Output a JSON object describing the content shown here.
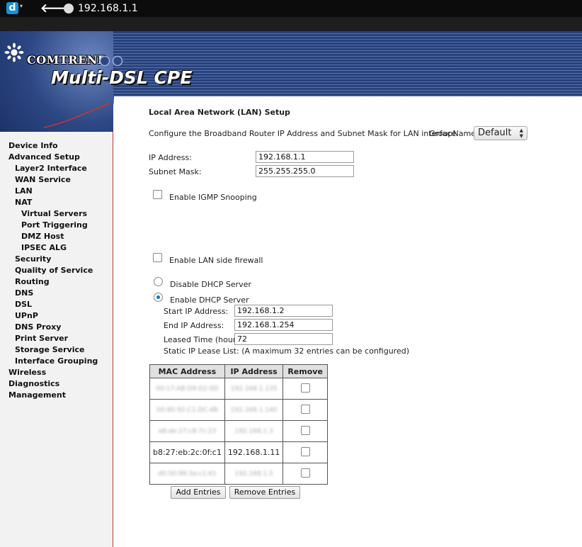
{
  "browser": {
    "address": "192.168.1.1",
    "app_icon_letter": "d",
    "icons": {
      "app": "d-browser-icon",
      "back": "back-arrow-icon",
      "site": "globe-icon"
    }
  },
  "banner": {
    "brand": "COMTREND",
    "product": "Multi-DSL CPE",
    "colors": {
      "banner_dark": "#243a6e",
      "banner_light": "#8fa3cc",
      "divider_red": "#cc3333"
    }
  },
  "sidebar": {
    "items": [
      {
        "label": "Device Info"
      },
      {
        "label": "Advanced Setup"
      },
      {
        "label": "Layer2 Interface"
      },
      {
        "label": "WAN Service"
      },
      {
        "label": "LAN"
      },
      {
        "label": "NAT"
      },
      {
        "label": "Virtual Servers"
      },
      {
        "label": "Port Triggering"
      },
      {
        "label": "DMZ Host"
      },
      {
        "label": "IPSEC ALG"
      },
      {
        "label": "Security"
      },
      {
        "label": "Quality of Service"
      },
      {
        "label": "Routing"
      },
      {
        "label": "DNS"
      },
      {
        "label": "DSL"
      },
      {
        "label": "UPnP"
      },
      {
        "label": "DNS Proxy"
      },
      {
        "label": "Print Server"
      },
      {
        "label": "Storage Service"
      },
      {
        "label": "Interface Grouping"
      },
      {
        "label": "Wireless"
      },
      {
        "label": "Diagnostics"
      },
      {
        "label": "Management"
      }
    ]
  },
  "main": {
    "title": "Local Area Network (LAN) Setup",
    "description": "Configure the Broadband Router IP Address and Subnet Mask for LAN interface.",
    "group_name_label": "GroupName",
    "group_name_value": "Default",
    "ip_address_label": "IP Address:",
    "ip_address_value": "192.168.1.1",
    "subnet_mask_label": "Subnet Mask:",
    "subnet_mask_value": "255.255.255.0",
    "igmp_label": "Enable IGMP Snooping",
    "igmp_checked": false,
    "firewall_label": "Enable LAN side firewall",
    "firewall_checked": false,
    "dhcp_disable_label": "Disable DHCP Server",
    "dhcp_enable_label": "Enable DHCP Server",
    "dhcp_selected": "enable",
    "start_ip_label": "Start IP Address:",
    "start_ip_value": "192.168.1.2",
    "end_ip_label": "End IP Address:",
    "end_ip_value": "192.168.1.254",
    "lease_time_label": "Leased Time (hour):",
    "lease_time_value": "72",
    "static_lease_note": "Static IP Lease List: (A maximum 32 entries can be configured)",
    "table": {
      "headers": [
        "MAC Address",
        "IP Address",
        "Remove"
      ],
      "rows": [
        {
          "mac": "00:17:AB:D9:D2:0D",
          "ip": "192.168.1.135",
          "blurred": true
        },
        {
          "mac": "00:80:92:C1:DC:4B",
          "ip": "192.168.1.140",
          "blurred": true
        },
        {
          "mac": "a8:de:27:c8:7c:23",
          "ip": "192.168.1.3",
          "blurred": true
        },
        {
          "mac": "b8:27:eb:2c:0f:c1",
          "ip": "192.168.1.11",
          "blurred": false
        },
        {
          "mac": "d0:50:99:3a:c1:61",
          "ip": "192.168.1.5",
          "blurred": true
        }
      ]
    },
    "add_button": "Add Entries",
    "remove_button": "Remove Entries"
  }
}
